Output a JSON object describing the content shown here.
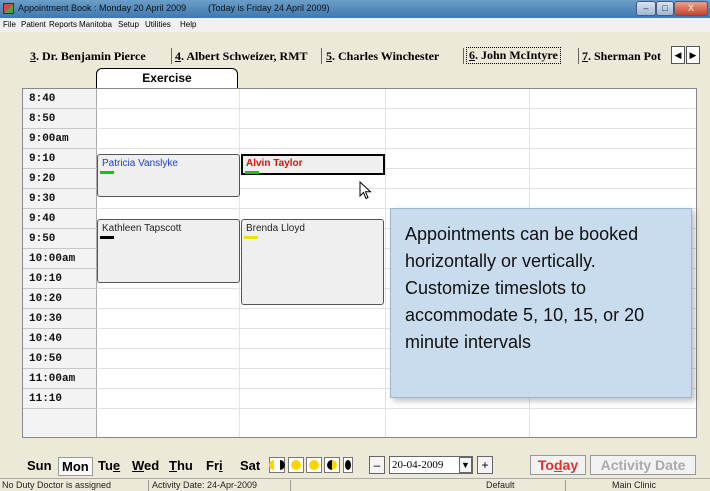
{
  "window": {
    "title": "Appointment Book : Monday 20 April 2009",
    "today_note": "(Today is Friday 24 April 2009)",
    "controls": {
      "minimize": "–",
      "maximize": "□",
      "close": "X"
    }
  },
  "menu": [
    "File",
    "Patient",
    "Reports",
    "Manitoba",
    "Setup",
    "Utilities",
    "Help"
  ],
  "doctor_tabs": [
    {
      "num": "3",
      "name": ". Dr. Benjamin Pierce"
    },
    {
      "num": "4",
      "name": ". Albert Schweizer, RMT"
    },
    {
      "num": "5",
      "name": ". Charles Winchester"
    },
    {
      "num": "6",
      "name": ". John McIntyre"
    },
    {
      "num": "7",
      "name": ". Sherman Pot"
    }
  ],
  "tab_arrows": {
    "left": "◀",
    "right": "▶"
  },
  "column_tab": "Exercise",
  "timeslots": [
    "8:40",
    "8:50",
    "9:00am",
    "9:10",
    "9:20",
    "9:30",
    "9:40",
    "9:50",
    "10:00am",
    "10:10",
    "10:20",
    "10:30",
    "10:40",
    "10:50",
    "11:00am",
    "11:10"
  ],
  "appointments": [
    {
      "name": "Patricia Vanslyke",
      "color": "#1a3fd0",
      "bar_color": "#18c018"
    },
    {
      "name": "Alvin Taylor",
      "color": "#e01010",
      "bar_color": "#18c018"
    },
    {
      "name": "Kathleen Tapscott",
      "color": "#222222",
      "bar_color": "#000000"
    },
    {
      "name": "Brenda Lloyd",
      "color": "#222222",
      "bar_color": "#f0e000"
    }
  ],
  "callout": "Appointments can be booked horizontally or vertically. Customize timeslots to accommodate 5, 10, 15, or 20 minute intervals",
  "days": [
    {
      "pre": "Sun",
      "u": "",
      "post": ""
    },
    {
      "pre": "Mon",
      "u": "",
      "post": ""
    },
    {
      "pre": "Tu",
      "u": "e",
      "post": ""
    },
    {
      "pre": "",
      "u": "W",
      "post": "ed"
    },
    {
      "pre": "",
      "u": "T",
      "post": "hu"
    },
    {
      "pre": "Fr",
      "u": "i",
      "post": ""
    },
    {
      "pre": "Sat",
      "u": "",
      "post": ""
    }
  ],
  "date": {
    "value": "20-04-2009",
    "dropdown": "▼",
    "minus": "–",
    "plus": "+"
  },
  "buttons": {
    "today_pre": "To",
    "today_u": "d",
    "today_post": "ay",
    "activity": "Activity Date"
  },
  "status": {
    "left": "No Duty Doctor is assigned",
    "activity": "Activity Date: 24-Apr-2009",
    "mode": "Default",
    "location": "Main Clinic"
  }
}
